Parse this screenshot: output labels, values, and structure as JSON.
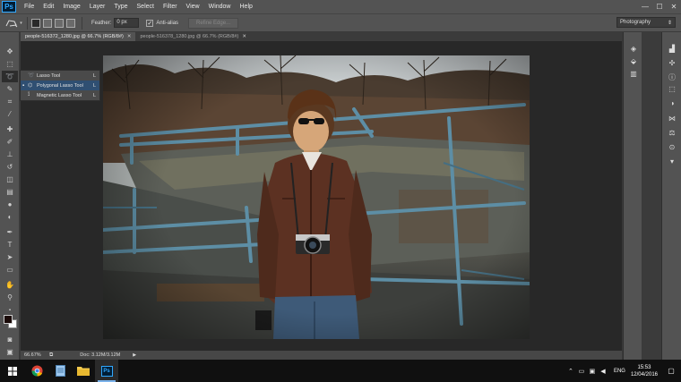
{
  "app": {
    "logo": "Ps",
    "menu": [
      "File",
      "Edit",
      "Image",
      "Layer",
      "Type",
      "Select",
      "Filter",
      "View",
      "Window",
      "Help"
    ],
    "window_controls": [
      "—",
      "☐",
      "✕"
    ]
  },
  "options": {
    "feather_label": "Feather:",
    "feather_value": "0 px",
    "antialias_label": "Anti-alias",
    "antialias_checked": true,
    "refine_edge_label": "Refine Edge...",
    "workspace": "Photography"
  },
  "tabs": [
    {
      "label": "people-516372_1280.jpg @ 66.7% (RGB/8#)",
      "active": true
    },
    {
      "label": "people-516378_1280.jpg @ 66.7% (RGB/8#)",
      "active": false
    }
  ],
  "flyout": {
    "items": [
      {
        "label": "Lasso Tool",
        "key": "L",
        "icon": "lasso-icon",
        "active": false
      },
      {
        "label": "Polygonal Lasso Tool",
        "key": "L",
        "icon": "polygonal-lasso-icon",
        "active": true
      },
      {
        "label": "Magnetic Lasso Tool",
        "key": "L",
        "icon": "magnetic-lasso-icon",
        "active": false
      }
    ]
  },
  "status": {
    "zoom": "66.67%",
    "doc": "Doc: 3.12M/3.12M"
  },
  "colors": {
    "foreground": "#1a0a08",
    "background": "#ffffff",
    "accent": "#31a8ff"
  },
  "taskbar": {
    "apps": [
      "chrome-icon",
      "notepad-icon",
      "file-explorer-icon",
      "photoshop-icon"
    ],
    "lang": "ENG",
    "time": "15:53",
    "date": "12/04/2016"
  }
}
